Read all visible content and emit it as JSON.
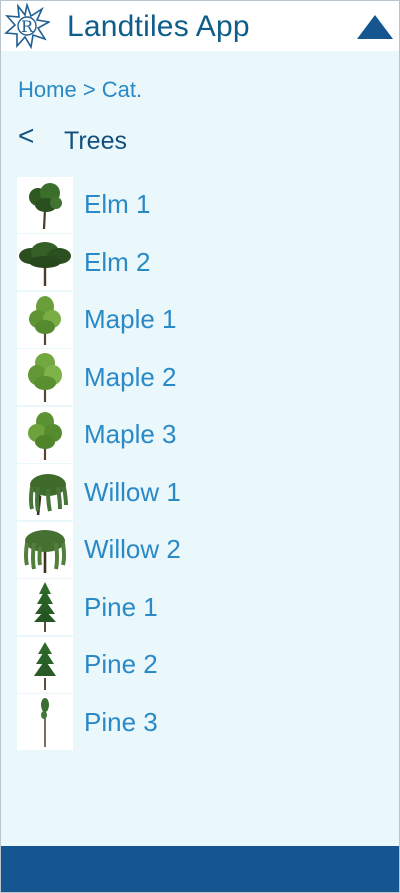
{
  "header": {
    "app_title": "Landtiles App",
    "logo_letter": "R",
    "menu_icon": "triangle-up-icon"
  },
  "breadcrumb": {
    "home": "Home",
    "separator": ">",
    "category": "Cat."
  },
  "section": {
    "back_label": "<",
    "title": "Trees"
  },
  "items": [
    {
      "label": "Elm 1",
      "icon": "elm-tree-icon"
    },
    {
      "label": "Elm 2",
      "icon": "elm-tree-icon"
    },
    {
      "label": "Maple 1",
      "icon": "maple-tree-icon"
    },
    {
      "label": "Maple 2",
      "icon": "maple-tree-icon"
    },
    {
      "label": "Maple 3",
      "icon": "maple-tree-icon"
    },
    {
      "label": "Willow 1",
      "icon": "willow-tree-icon"
    },
    {
      "label": "Willow 2",
      "icon": "willow-tree-icon"
    },
    {
      "label": "Pine 1",
      "icon": "pine-tree-icon"
    },
    {
      "label": "Pine 2",
      "icon": "pine-tree-icon"
    },
    {
      "label": "Pine 3",
      "icon": "pine-tree-icon"
    }
  ],
  "colors": {
    "brand_dark": "#165690",
    "link_blue": "#2a8ac7",
    "background": "#eaf7fb"
  }
}
